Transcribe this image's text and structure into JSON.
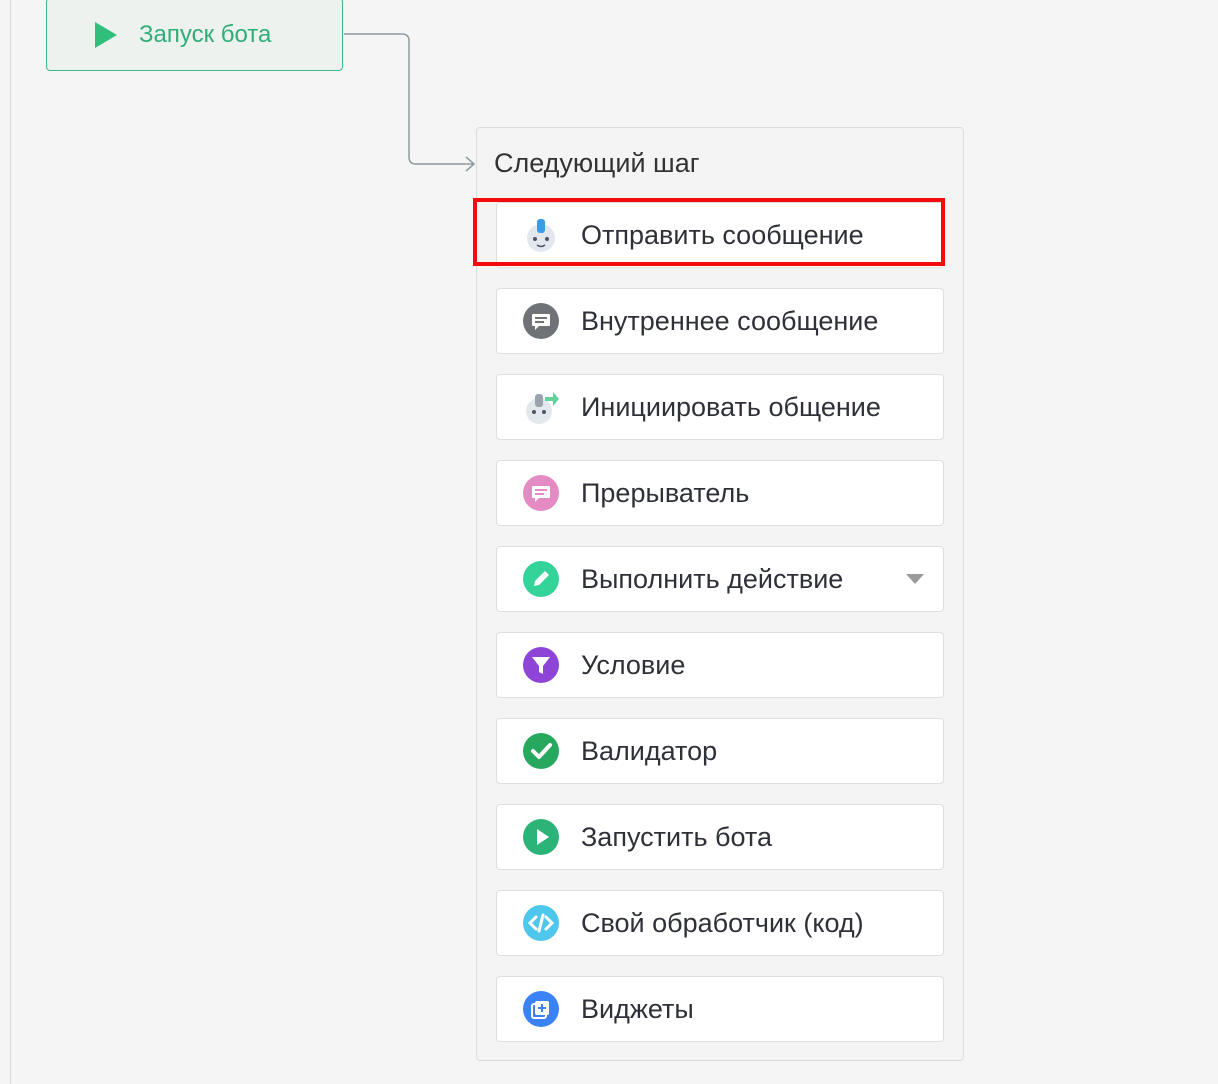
{
  "start_node": {
    "label": "Запуск бота"
  },
  "panel": {
    "title": "Следующий шаг",
    "items": [
      {
        "label": "Отправить сообщение",
        "icon": "robot-icon",
        "highlighted": true
      },
      {
        "label": "Внутреннее сообщение",
        "icon": "chat-bubble-gray-icon"
      },
      {
        "label": "Инициировать общение",
        "icon": "robot-arrow-icon"
      },
      {
        "label": "Прерыватель",
        "icon": "chat-bubble-pink-icon"
      },
      {
        "label": "Выполнить действие",
        "icon": "pencil-icon",
        "has_dropdown": true
      },
      {
        "label": "Условие",
        "icon": "filter-icon"
      },
      {
        "label": "Валидатор",
        "icon": "check-icon"
      },
      {
        "label": "Запустить бота",
        "icon": "play-icon"
      },
      {
        "label": "Свой обработчик (код)",
        "icon": "code-icon"
      },
      {
        "label": "Виджеты",
        "icon": "widgets-icon"
      }
    ]
  },
  "colors": {
    "accent_green": "#2fbf7a",
    "highlight_red": "#f20c0c"
  }
}
